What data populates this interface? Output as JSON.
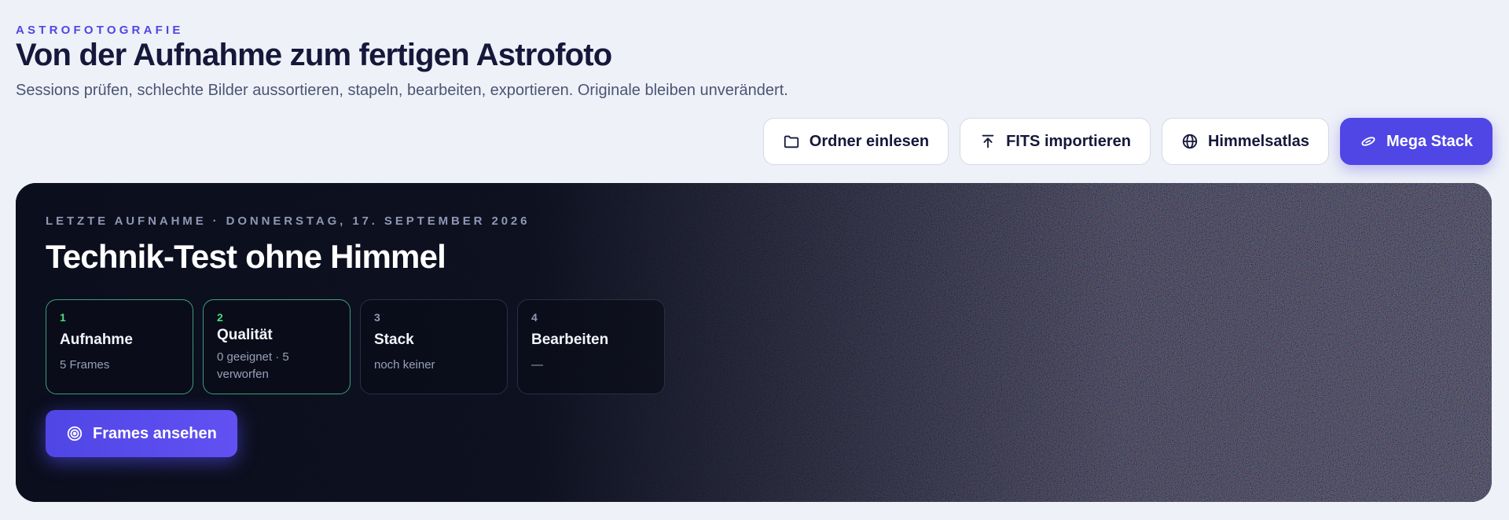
{
  "header": {
    "eyebrow": "ASTROFOTOGRAFIE",
    "title": "Von der Aufnahme zum fertigen Astrofoto",
    "subtitle": "Sessions prüfen, schlechte Bilder aussortieren, stapeln, bearbeiten, exportieren. Originale bleiben unverändert."
  },
  "actions": [
    {
      "label": "Ordner einlesen",
      "icon": "folder-icon"
    },
    {
      "label": "FITS importieren",
      "icon": "upload-icon"
    },
    {
      "label": "Himmelsatlas",
      "icon": "globe-icon"
    },
    {
      "label": "Mega Stack",
      "icon": "galaxy-icon"
    }
  ],
  "hero": {
    "eyebrow": "LETZTE AUFNAHME · DONNERSTAG, 17. SEPTEMBER 2026",
    "title": "Technik-Test ohne Himmel",
    "steps": [
      {
        "num": "1",
        "label": "Aufnahme",
        "detail": "5 Frames",
        "status": "done"
      },
      {
        "num": "2",
        "label": "Qualität",
        "detail": "0 geeignet · 5 verworfen",
        "status": "done"
      },
      {
        "num": "3",
        "label": "Stack",
        "detail": "noch keiner",
        "status": "pending"
      },
      {
        "num": "4",
        "label": "Bearbeiten",
        "detail": "—",
        "status": "pending"
      }
    ],
    "cta_label": "Frames ansehen",
    "cta_icon": "target-icon"
  },
  "colors": {
    "accent": "#4f46e5",
    "background": "#eef1f7",
    "hero_bg": "#0b0e1d",
    "step_done": "#4ade80"
  }
}
